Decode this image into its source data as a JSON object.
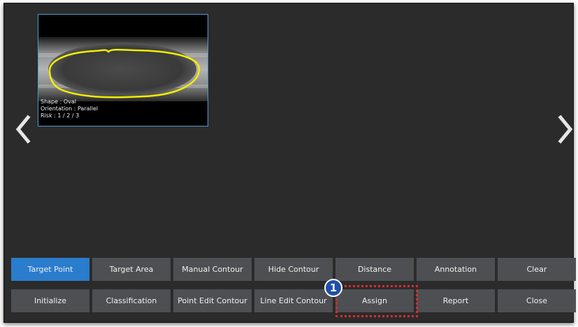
{
  "thumbnail": {
    "shape_line": "Shape : Oval",
    "orientation_line": "Orientation : Parallel",
    "risk_line": "Risk : 1 / 2 / 3",
    "contour_color": "#f2ee00",
    "frame_color": "#4f9ad6"
  },
  "nav": {
    "prev_icon": "chevron-left-icon",
    "next_icon": "chevron-right-icon"
  },
  "toolbar": {
    "row1": [
      "Target Point",
      "Target Area",
      "Manual Contour",
      "Hide Contour",
      "Distance",
      "Annotation",
      "Clear"
    ],
    "row2": [
      "Initialize",
      "Classification",
      "Point Edit Contour",
      "Line Edit Contour",
      "Assign",
      "Report",
      "Close"
    ],
    "active_button": "Target Point",
    "active_color": "#2a7ccc",
    "button_color": "#4d4f52"
  },
  "callout": {
    "number": "1",
    "target": "Assign",
    "highlight_color": "#e02a2a",
    "badge_color": "#1f4fa8"
  }
}
